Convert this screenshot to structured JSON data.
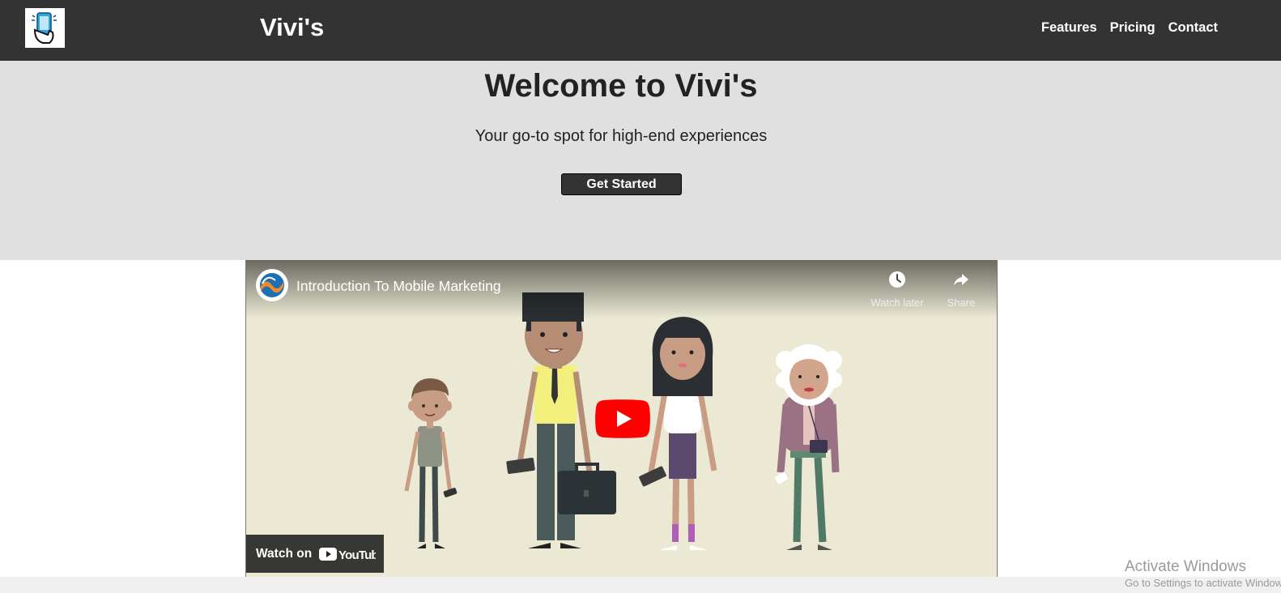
{
  "header": {
    "brand": "Vivi's",
    "nav": [
      {
        "label": "Features"
      },
      {
        "label": "Pricing"
      },
      {
        "label": "Contact"
      }
    ]
  },
  "hero": {
    "title": "Welcome to Vivi's",
    "subtitle": "Your go-to spot for high-end experiences",
    "cta_label": "Get Started"
  },
  "video": {
    "title": "Introduction To Mobile Marketing",
    "watch_later_label": "Watch later",
    "share_label": "Share",
    "watch_on_label": "Watch on",
    "youtube_wordmark": "YouTube"
  },
  "watermark": {
    "title": "Activate Windows",
    "subtitle": "Go to Settings to activate Windows."
  },
  "colors": {
    "header_bg": "#333333",
    "hero_bg": "#e0e0e0",
    "cta_bg": "#333333",
    "video_bg": "#ebe9d3",
    "play_red": "#ff0000"
  },
  "icons": [
    "phone-hand-logo-icon",
    "channel-avatar-icon",
    "clock-icon",
    "share-arrow-icon",
    "play-icon",
    "youtube-logo-icon"
  ]
}
